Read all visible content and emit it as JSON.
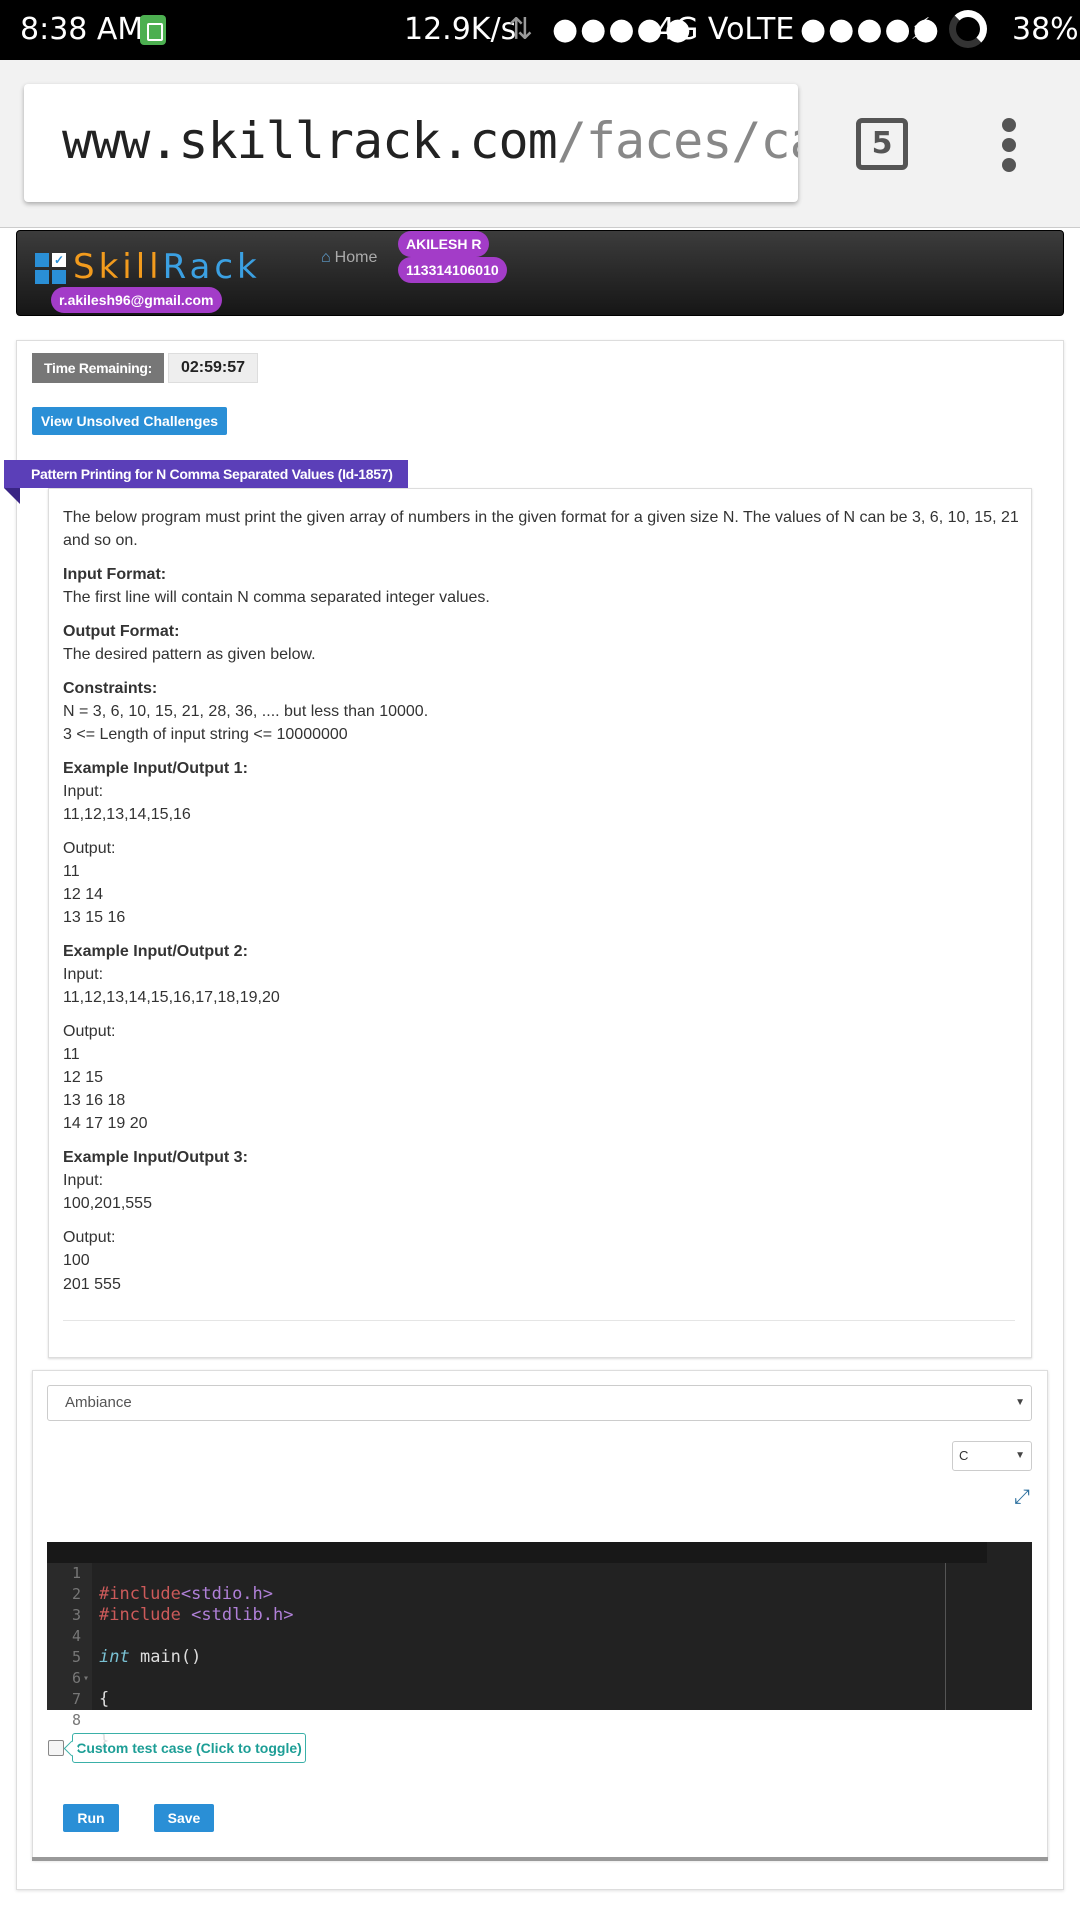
{
  "status_bar": {
    "time": "8:38 AM",
    "speed": "12.9K/s",
    "arrows": "⇅",
    "signal1": "●●●●●",
    "network": "4G VoLTE",
    "signal2": "●●●●●",
    "charging": "⚡",
    "battery": "38%"
  },
  "browser": {
    "url_domain": "www.skillrack.com",
    "url_path": "/faces/candi",
    "tab_count": "5"
  },
  "site_header": {
    "logo_skill": "Skill",
    "logo_rack": "Rack",
    "logo_check": "✓",
    "email": "r.akilesh96@gmail.com",
    "home_icon": "⌂",
    "home_label": "Home",
    "user_name": "AKILESH R",
    "user_id": "113314106010"
  },
  "timer": {
    "label": "Time Remaining:",
    "value": "02:59:57"
  },
  "unsolved_button": "View Unsolved Challenges",
  "problem": {
    "title": "Pattern Printing for N Comma Separated Values (Id-1857)",
    "description": "The below program must print the given array of numbers in the given format for a given size N. The values of N can be 3, 6, 10, 15, 21 and so on.",
    "input_format_heading": "Input Format:",
    "input_format": "The first line will contain N comma separated integer values.",
    "output_format_heading": "Output Format:",
    "output_format": "The desired pattern as given below.",
    "constraints_heading": "Constraints:",
    "constraints": [
      "N = 3, 6, 10, 15, 21, 28, 36, .... but less than 10000.",
      "3 <= Length of input string <= 10000000"
    ],
    "examples": [
      {
        "heading": "Example Input/Output 1:",
        "input_label": "Input:",
        "input": "11,12,13,14,15,16",
        "output_label": "Output:",
        "output": [
          "11",
          "12 14",
          "13 15 16"
        ]
      },
      {
        "heading": "Example Input/Output 2:",
        "input_label": "Input:",
        "input": "11,12,13,14,15,16,17,18,19,20",
        "output_label": "Output:",
        "output": [
          "11",
          "12 15",
          "13 16 18",
          "14 17 19 20"
        ]
      },
      {
        "heading": "Example Input/Output 3:",
        "input_label": "Input:",
        "input": "100,201,555",
        "output_label": "Output:",
        "output": [
          "100",
          "201 555"
        ]
      }
    ]
  },
  "editor": {
    "theme": "Ambiance",
    "language": "C",
    "expand_icon": "⤢",
    "select_caret": "▼",
    "fold_marker": "▾",
    "line_numbers": [
      "1",
      "2",
      "3",
      "4",
      "5",
      "6",
      "7",
      "8"
    ],
    "code": {
      "l1_directive": "#include",
      "l1_header": "<stdio.h>",
      "l2_directive": "#include",
      "l2_header": "<stdlib.h>",
      "l4_type": "int",
      "l4_rest": " main()",
      "l5": "{",
      "l8": "}"
    },
    "custom_test_label": "Custom test case (Click to toggle)",
    "run_label": "Run",
    "save_label": "Save"
  },
  "colors": {
    "brand_blue": "#2a8fd6",
    "brand_orange": "#f29b1d",
    "user_pill": "#a33cc8",
    "ribbon_purple": "#5b3fb8",
    "teal": "#1d9e96"
  }
}
